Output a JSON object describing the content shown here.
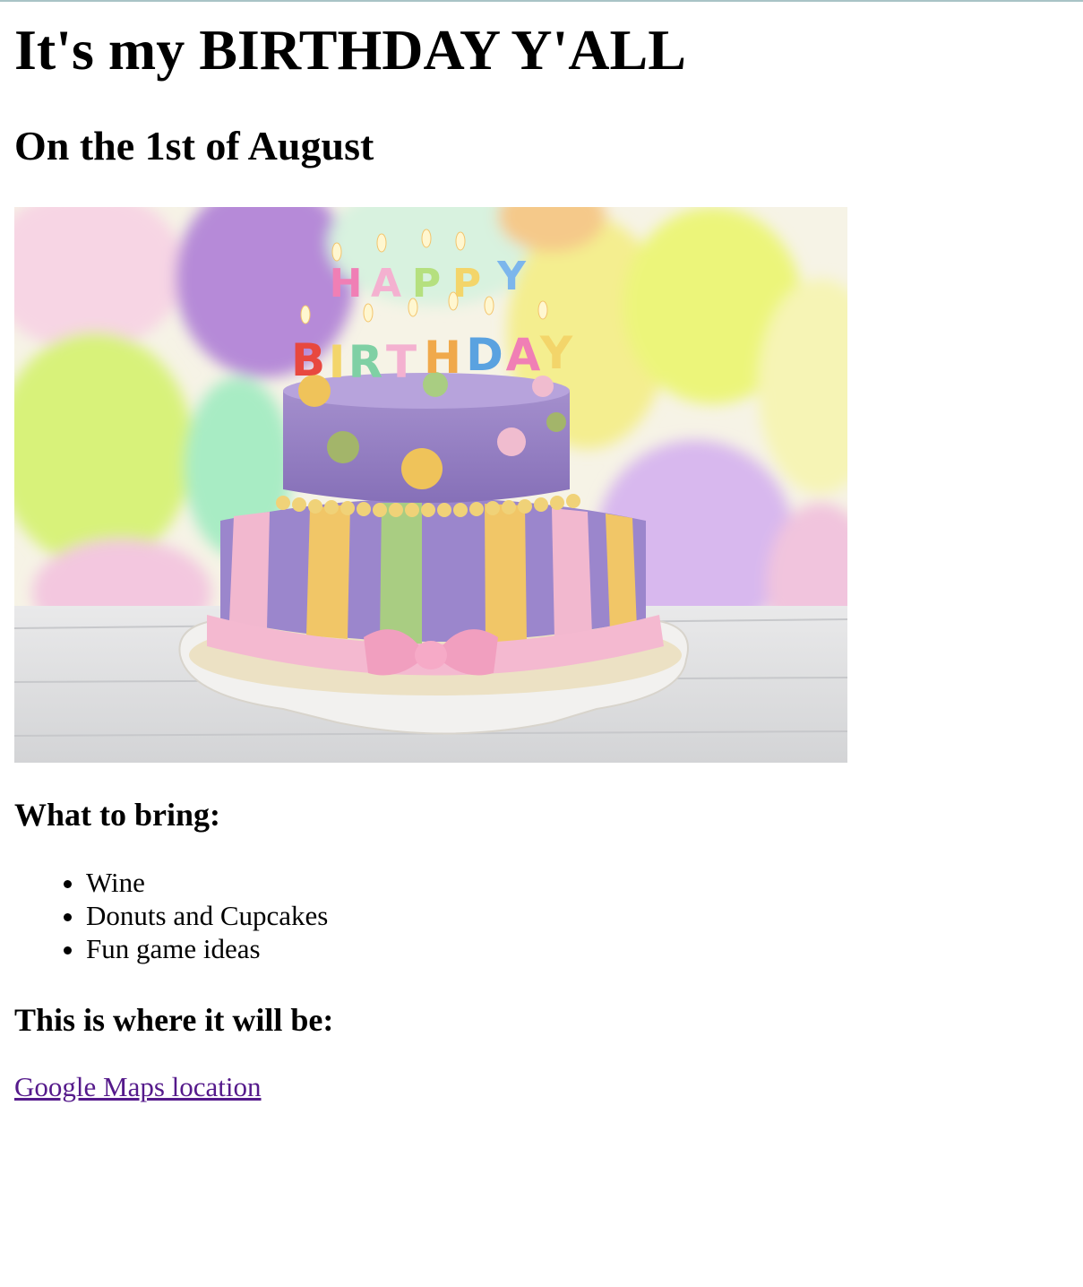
{
  "header": {
    "title": "It's my BIRTHDAY Y'ALL",
    "subtitle": "On the 1st of August"
  },
  "hero_image": {
    "description_icon": "birthday-cake-image",
    "cake_candle_text_top": "HAPPY",
    "cake_candle_text_bottom": "BIRTHDAY"
  },
  "bring_section": {
    "heading": "What to bring:",
    "items": [
      "Wine",
      "Donuts and Cupcakes",
      "Fun game ideas"
    ]
  },
  "location_section": {
    "heading": "This is where it will be:",
    "link_text": "Google Maps location"
  },
  "colors": {
    "link_visited": "#551a8b",
    "text": "#000000",
    "background": "#ffffff"
  }
}
